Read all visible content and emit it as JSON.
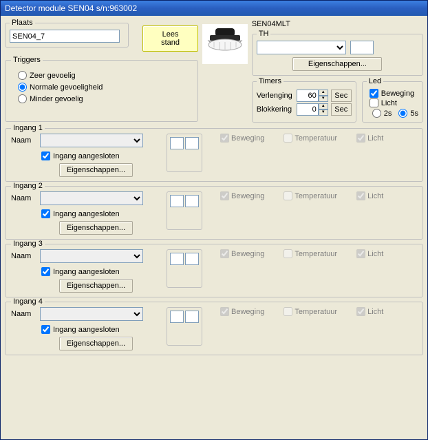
{
  "title": "Detector module SEN04 s/n:963002",
  "plaats": {
    "legend": "Plaats",
    "value": "SEN04_7"
  },
  "lees_stand": "Lees stand",
  "model": "SEN04MLT",
  "th": {
    "legend": "TH",
    "props_btn": "Eigenschappen..."
  },
  "triggers": {
    "legend": "Triggers",
    "opt1": "Zeer gevoelig",
    "opt2": "Normale gevoeligheid",
    "opt3": "Minder gevoelig",
    "selected": 1
  },
  "timers": {
    "legend": "Timers",
    "verlenging_lbl": "Verlenging",
    "verlenging_val": "60",
    "blokkering_lbl": "Blokkering",
    "blokkering_val": "0",
    "unit": "Sec"
  },
  "led": {
    "legend": "Led",
    "beweging": "Beweging",
    "licht": "Licht",
    "r1": "2s",
    "r2": "5s"
  },
  "ingang_common": {
    "naam_lbl": "Naam",
    "aangesloten": "Ingang aangesloten",
    "props": "Eigenschappen...",
    "beweging": "Beweging",
    "temperatuur": "Temperatuur",
    "licht": "Licht"
  },
  "ingangen": [
    {
      "legend": "Ingang 1"
    },
    {
      "legend": "Ingang 2"
    },
    {
      "legend": "Ingang 3"
    },
    {
      "legend": "Ingang 4"
    }
  ]
}
